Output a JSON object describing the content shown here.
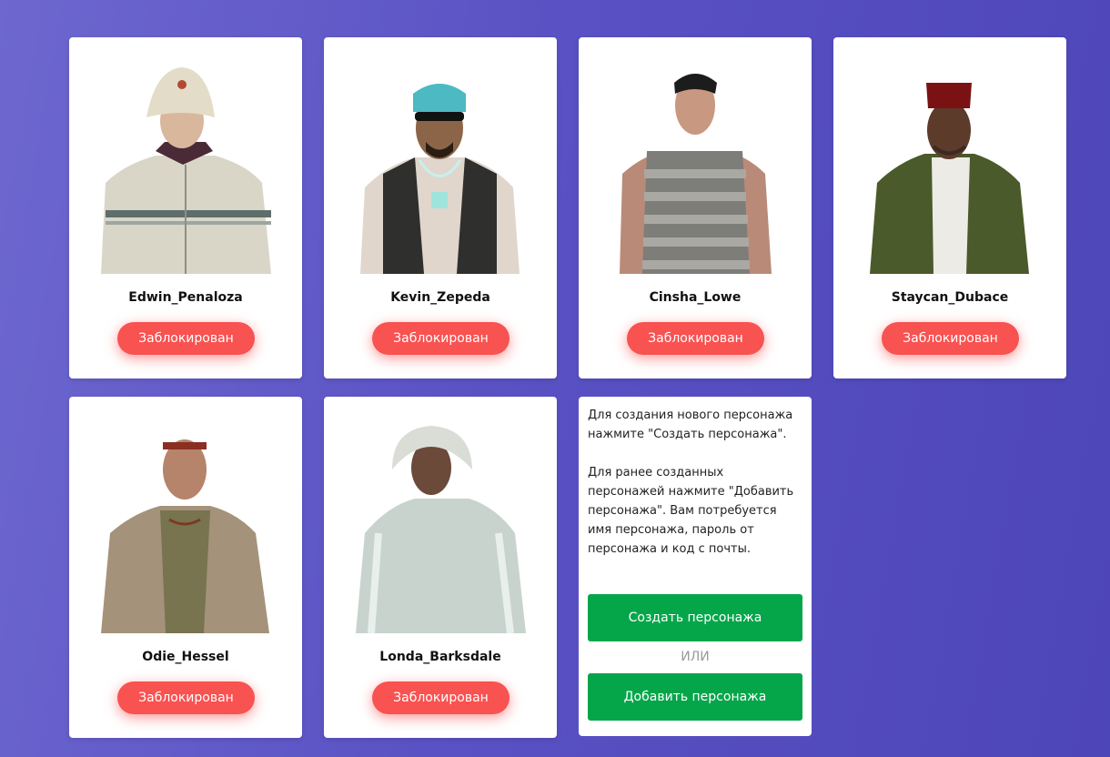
{
  "characters": [
    {
      "name": "Edwin_Penaloza",
      "status": "Заблокирован",
      "skin": "white-bucket-hat-jacket"
    },
    {
      "name": "Kevin_Zepeda",
      "status": "Заблокирован",
      "skin": "bandana-vest-chain"
    },
    {
      "name": "Cinsha_Lowe",
      "status": "Заблокирован",
      "skin": "striped-tank-top"
    },
    {
      "name": "Staycan_Dubace",
      "status": "Заблокирован",
      "skin": "fez-green-jacket"
    },
    {
      "name": "Odie_Hessel",
      "status": "Заблокирован",
      "skin": "elder-headband-shirt"
    },
    {
      "name": "Londa_Barksdale",
      "status": "Заблокирован",
      "skin": "white-hood-jacket"
    }
  ],
  "info": {
    "text": "Для создания нового персонажа нажмите \"Создать персонажа\".\n\nДля ранее созданных персонажей нажмите \"Добавить персонажа\". Вам потребуется имя персонажа, пароль от персонажа и код с почты.",
    "create_label": "Создать персонажа",
    "or_label": "ИЛИ",
    "add_label": "Добавить персонажа"
  },
  "colors": {
    "blocked": "#f85251",
    "action": "#05a64a",
    "background": "#5a52c4"
  }
}
